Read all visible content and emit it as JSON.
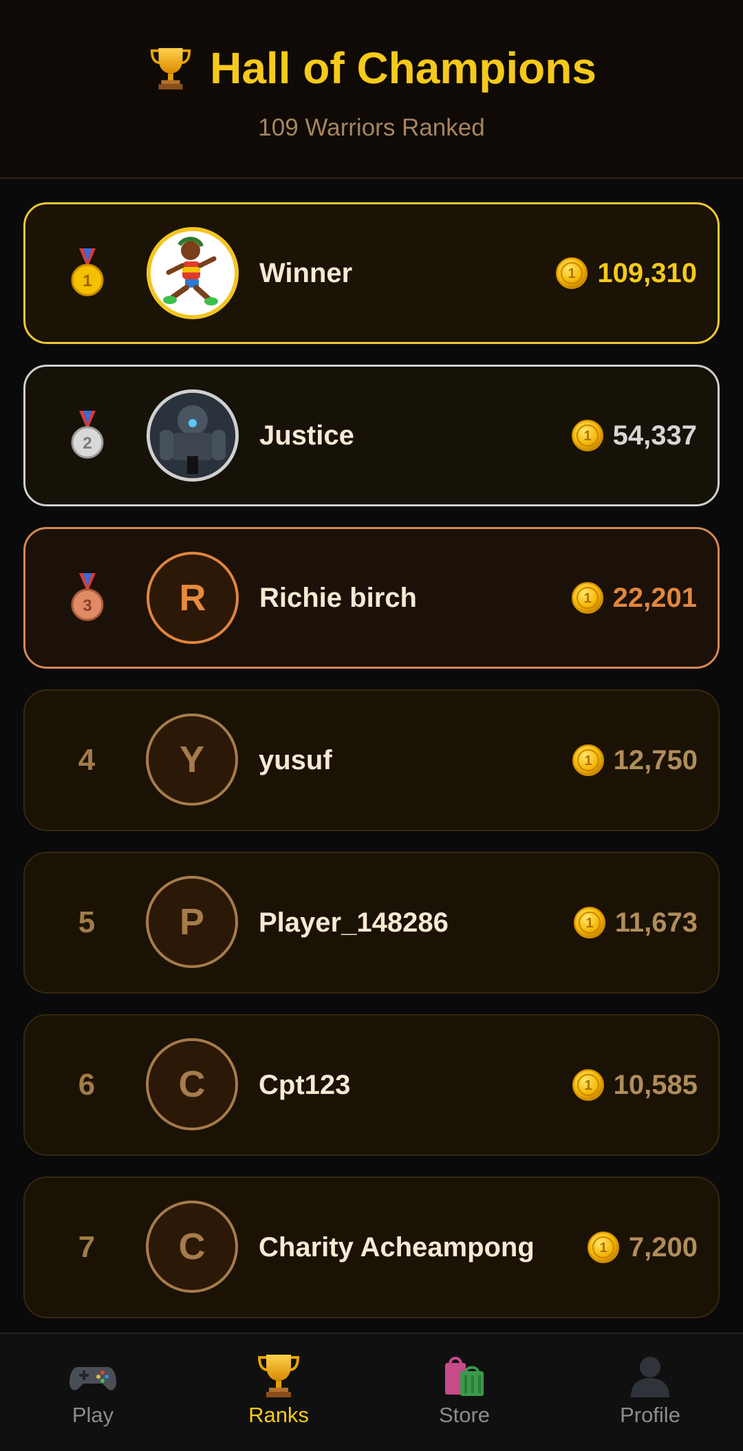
{
  "header": {
    "title": "Hall of Champions",
    "subtitle": "109 Warriors Ranked",
    "icon": "trophy-icon"
  },
  "leaderboard": [
    {
      "rank": "1",
      "name": "Winner",
      "score": "109,310",
      "avatar_initial": "",
      "avatar": "runner-character-image",
      "tier": "gold"
    },
    {
      "rank": "2",
      "name": "Justice",
      "score": "54,337",
      "avatar_initial": "",
      "avatar": "robot-mech-image",
      "tier": "silver"
    },
    {
      "rank": "3",
      "name": "Richie birch",
      "score": "22,201",
      "avatar_initial": "R",
      "tier": "bronze"
    },
    {
      "rank": "4",
      "name": "yusuf",
      "score": "12,750",
      "avatar_initial": "Y",
      "tier": "normal"
    },
    {
      "rank": "5",
      "name": "Player_148286",
      "score": "11,673",
      "avatar_initial": "P",
      "tier": "normal"
    },
    {
      "rank": "6",
      "name": "Cpt123",
      "score": "10,585",
      "avatar_initial": "C",
      "tier": "normal"
    },
    {
      "rank": "7",
      "name": "Charity Acheampong",
      "score": "7,200",
      "avatar_initial": "C",
      "tier": "normal"
    }
  ],
  "nav": {
    "items": [
      {
        "label": "Play",
        "icon": "gamepad-icon"
      },
      {
        "label": "Ranks",
        "icon": "trophy-icon",
        "active": true
      },
      {
        "label": "Store",
        "icon": "shopping-bags-icon"
      },
      {
        "label": "Profile",
        "icon": "user-icon"
      }
    ]
  },
  "colors": {
    "accent": "#f6c91a",
    "gold": "#f3c732",
    "silver": "#cfcfcf",
    "bronze": "#d58858",
    "card_bg": "#1b1206"
  }
}
